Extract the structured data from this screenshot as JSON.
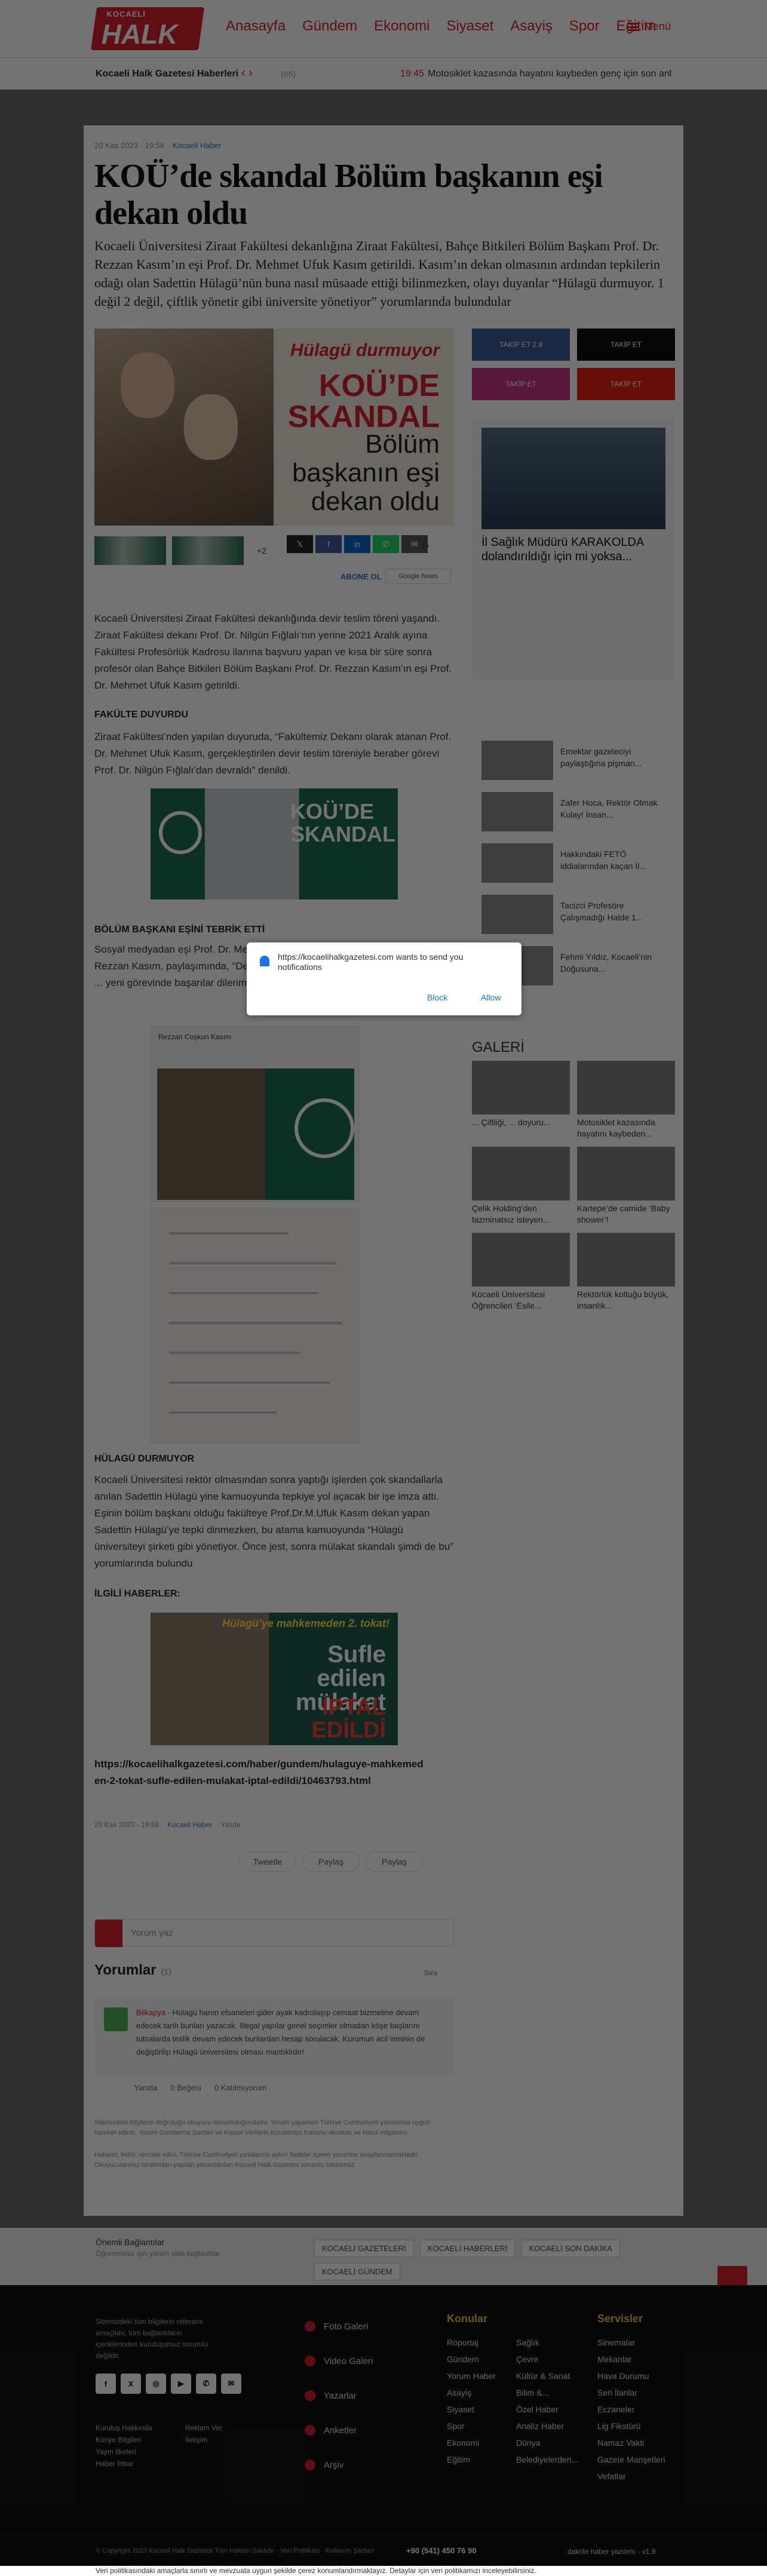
{
  "header": {
    "logo_small": "KOCAELİ",
    "logo_big": "HALK",
    "nav": [
      "Anasayfa",
      "Gündem",
      "Ekonomi",
      "Siyaset",
      "Asayiş",
      "Spor",
      "Eğitim"
    ],
    "menu_label": "Menü"
  },
  "ticker": {
    "label": "Kocaeli Halk Gazetesi Haberleri",
    "tag": "(85)",
    "time": "19:45",
    "headline": "Motosiklet kazasında hayatını kaybeden genç için son anl"
  },
  "article": {
    "date": "20 Kas 2023 - 19:58",
    "category": "Kocaeli Haber",
    "title": "KOÜ’de skandal Bölüm başkanın eşi dekan oldu",
    "lead": "Kocaeli Üniversitesi Ziraat Fakültesi dekanlığına Ziraat Fakültesi, Bahçe Bitkileri Bölüm Başkanı Prof. Dr. Rezzan Kasım’ın eşi Prof. Dr. Mehmet Ufuk Kasım getirildi. Kasım’ın dekan olmasının ardından tepkilerin odağı olan Sadettin Hülagü’nün buna nasıl müsaade ettiği bilinmezken, olayı duyanlar “Hülagü durmuyor. 1 değil 2 değil, çiftlik yönetir gibi üniversite yönetiyor” yorumlarında bulundular",
    "hero_line1": "Hülagü durmuyor",
    "hero_line2": "KOÜ’DE SKANDAL",
    "hero_line3": "Bölüm başkanın eşi dekan oldu",
    "more_count": "+2",
    "share_icons": [
      "x-icon",
      "facebook-icon",
      "linkedin-icon",
      "whatsapp-icon",
      "mail-icon"
    ],
    "font_size_label": "A",
    "follow_label": "ABONE OL",
    "gnews_label": "Google News",
    "para1": "Kocaeli Üniversitesi Ziraat Fakültesi dekanlığında devir teslim töreni yaşandı. Ziraat Fakültesi dekanı Prof. Dr. Nilgün Fığlalı’nın yerine 2021 Aralık ayına Fakültesi Profesörlük Kadrosu ilanına başvuru yapan ve kısa bir süre sonra profesör olan Bahçe Bitkileri Bölüm Başkanı Prof. Dr. Rezzan Kasım’ın eşi Prof. Dr. Mehmet Ufuk Kasım getirildi.",
    "sub1": "FAKÜLTE DUYURDU",
    "para2": "Ziraat Fakültesi’nden yapılan duyuruda, “Fakültemiz Dekanı olarak atanan Prof. Dr. Mehmet Ufuk Kasım, gerçekleştirilen devir teslim töreniyle beraber görevi Prof. Dr. Nilgün Fığlalı’dan devraldı” denildi.",
    "img1_text": "KOÜ’DE SKANDAL",
    "sub2": "BÖLÜM BAŞKANI EŞİNİ TEBRİK ETTİ",
    "para3": "Sosyal medyadan eşi Prof. Dr. Mehmet Ufuk Kasım’ı tebrik eden Prof. Dr. Rezzan Kasım, paylaşımında, “Değerli eşime ... yapıldı. Yeni dekanımız sevgili ... yeni görevinde başarılar dilerim” ...",
    "fb_name": "Rezzan Coşkun Kasım",
    "sub3": "HÜLAGÜ DURMUYOR",
    "para4": "Kocaeli Üniversitesi rektör olmasından sonra yaptığı işlerden çok skandallarla anılan Sadettin Hülagü yine kamuoyunda tepkiye yol açacak bir işe imza attı. Eşinin bölüm başkanı olduğu fakülteye Prof.Dr.M.Ufuk Kasım dekan yapan Sadettin Hülagü’ye tepki dinmezken, bu atama kamuoyunda “Hülagü üniversiteyi şirketi gibi yönetiyor. Önce jest, sonra mülakat skandalı şimdi de bu” yorumlarında bulundu",
    "sub4": "İLGİLİ HABERLER:",
    "rel_img_line1": "Hülagü’ye mahkemeden 2. tokat!",
    "rel_img_line2": "Sufle edilen mülakat",
    "rel_img_line3": "İPTAL EDİLDİ",
    "rel_link": "https://kocaelihalkgazetesi.com/haber/gundem/hulaguye-mahkemeden-2-tokat-sufle-edilen-mulakat-iptal-edildi/10463793.html",
    "foot_date": "20 Kas 2023 - 19:58",
    "foot_cat": "Kocaeli Haber",
    "foot_print": "Yazdır",
    "share_tw": "Tweetle",
    "share_fb": "Paylaş",
    "share_li": "Paylaş"
  },
  "comments": {
    "placeholder": "Yorum yaz",
    "heading": "Yorumlar",
    "count": "(1)",
    "sort": "Sıra",
    "author": "Bilkapya",
    "text": "- Hülagü hanın efsaneleri gider ayak kadrolaşıp cemaat bizmetine devam edecek tarih bunları yazacak. Illegal yapılar genel seçimler olmadan köşe başlarını tutsalarda teslik devam edecek bunlardan hesap sorulacak. Kurumun acil isminin de değiştirilip Hülagü üniversitesi olması mantıklıdır!",
    "reply": "Yanıtla",
    "likes": "0 Beğeni",
    "flag": "0 Katılmıyorum",
    "disclaimer1": "Sitemizdeki bilgilerin doğruluğu okuyucu sorumluluğundadır. Yorum yaparken Türkiye Cumhuriyeti yasalarına uygun hareket ediniz. Yorum Gönderme Şartları ve Kişisel Verilerin Korunması Kanunu okudum ve kabul ediyorum.",
    "disclaimer2": "Hakaret, küfür, rencide edici, Türkiye Cumhuriyeti yasalarına aykırı ifadeler içeren yorumlar onaylanmamaktadır. Okuyucularımız tarafından yapılan yorumlardan Kocaeli Halk Gazetesi sorumlu tutulamaz."
  },
  "sidebar": {
    "social": [
      {
        "label": "TAKİP ET 2.8",
        "color": "#3b5998"
      },
      {
        "label": "TAKİP ET",
        "color": "#111111"
      },
      {
        "label": "TAKİP ET",
        "color": "#c13584"
      },
      {
        "label": "TAKİP ET",
        "color": "#e62117"
      }
    ],
    "feature_title": "İl Sağlık Müdürü KARAKOLDA dolandırıldığı için mi yoksa...",
    "items": [
      "Emektar gazeteciyi paylaştığına pişman...",
      "Zafer Hoca, Rektör Olmak Kolay! İnsan...",
      "Hakkındaki FETÖ iddialarından kaçan İl...",
      "Tacizci Profesöre Çalışmadığı Halde 1...",
      "Fehmi Yıldız, Kocaeli’nin Doğusuna..."
    ],
    "galeri_label": "GALERİ",
    "gallery": [
      "... Çiftliği, ... doyuru...",
      "Motosiklet kazasında hayatını kaybeden...",
      "Çelik Holding’den tazminatsız isteyen...",
      "Kartepe’de camide ‘Baby shower’!",
      "Kocaeli Üniversitesi Öğrencileri ‘Esile...",
      "Rektörlük koltuğu büyük, insanlık..."
    ]
  },
  "tagbar": {
    "line1": "Önemli Bağlantılar",
    "line2": "Öğrenmeniz için yararlı olan bağlantılar",
    "tags": [
      "KOCAELİ GAZETELERİ",
      "KOCAELİ HABERLERİ",
      "KOCAELİ SON DAKİKA",
      "KOCAELİ GÜNDEM"
    ]
  },
  "footer": {
    "desc": "Sitemizdeki tüm bilgilerin referans amaçlıdır, tüm bağlantıların içeriklerinden kuruluşumuz sorumlu değildir.",
    "icons": [
      "f",
      "X",
      "◎",
      "▶",
      "✆",
      "✉"
    ],
    "links": [
      "Kuruluş Hakkında",
      "Reklam Ver",
      "Künye Bilgileri",
      "İletişim",
      "Yayın İlkeleri",
      "",
      "Haber İhbar",
      ""
    ],
    "media": [
      "Foto Galeri",
      "Video Galeri",
      "Yazarlar",
      "Anketler",
      "Arşiv"
    ],
    "konular_h": "Konular",
    "konular1": [
      "Röportaj",
      "Gündem",
      "Yorum Haber",
      "Asayiş",
      "Siyaset",
      "Spor",
      "Ekonomi",
      "Eğitim"
    ],
    "konular2": [
      "Sağlık",
      "Çevre",
      "Kültür & Sanat",
      "Bilim &...",
      "Özel Haber",
      "Analiz Haber",
      "Dünya",
      "Belediyelerden..."
    ],
    "servisler_h": "Servisler",
    "servisler": [
      "Sinemalar",
      "Mekanlar",
      "Hava Durumu",
      "Seri İlanlar",
      "Eczaneler",
      "Lig Fikstürü",
      "Namaz Vakti",
      "Gazete Manşetleri",
      "Vefatlar"
    ],
    "copyright": "© Copyright 2023 Kocaeli Halk Gazetesi Tüm Hakları Saklıdır  ·  Veri Politikası  ·  Kullanım Şartları",
    "phone": "+90 (541) 450 76 90",
    "credit": "dakrilo haber yazılımı - v1.9"
  },
  "cookie": "Veri politikasındaki amaçlarla sınırlı ve mevzuata uygun şekilde çerez konumlandırmaktayız. Detaylar için veri politikamızı inceleyebilirsiniz.",
  "notification": {
    "message": "https://kocaelihalkgazetesi.com wants to send you notifications",
    "block": "Block",
    "allow": "Allow"
  }
}
